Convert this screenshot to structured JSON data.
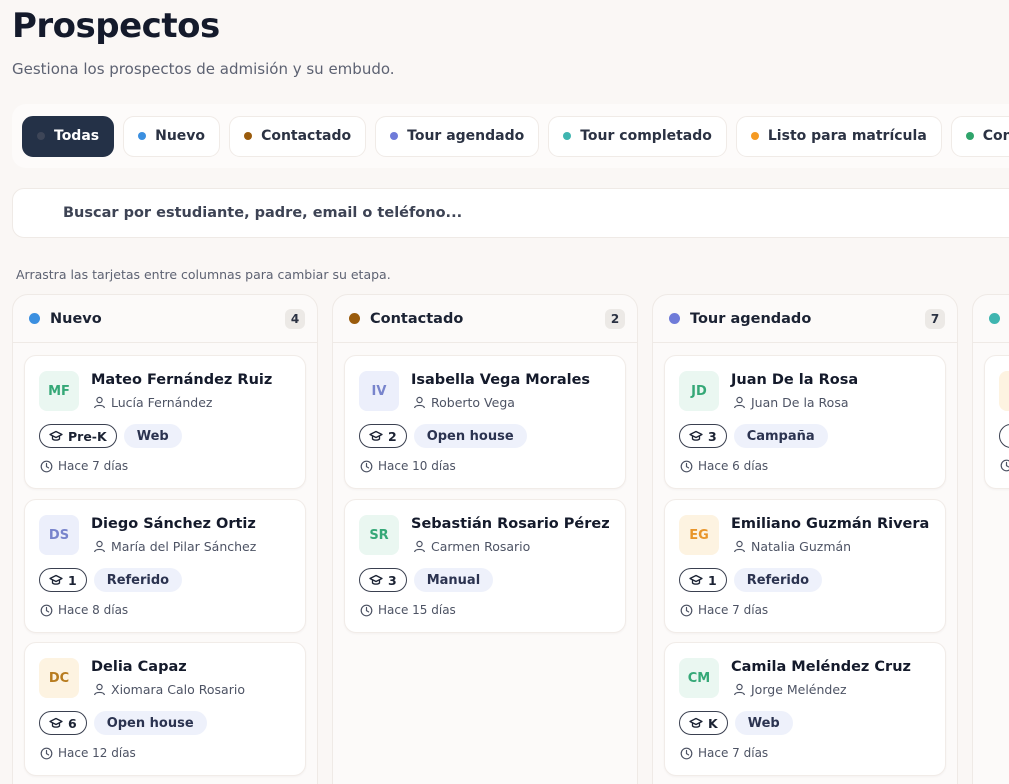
{
  "header": {
    "title": "Prospectos",
    "subtitle": "Gestiona los prospectos de admisión y su embudo."
  },
  "filters": [
    {
      "label": "Todas",
      "color": "#3d4557",
      "active": true
    },
    {
      "label": "Nuevo",
      "color": "#3b8fe0"
    },
    {
      "label": "Contactado",
      "color": "#9a5b0c"
    },
    {
      "label": "Tour agendado",
      "color": "#6f7bd9"
    },
    {
      "label": "Tour completado",
      "color": "#3fb5b0"
    },
    {
      "label": "Listo para matrícula",
      "color": "#f59a23"
    },
    {
      "label": "Convertido",
      "color": "#2fa46b"
    }
  ],
  "search": {
    "placeholder": "Buscar por estudiante, padre, email o teléfono...",
    "value": ""
  },
  "hint": "Arrastra las tarjetas entre columnas para cambiar su etapa.",
  "columns": [
    {
      "title": "Nuevo",
      "count": "4",
      "color": "#3b8fe0",
      "cards": [
        {
          "initials": "MF",
          "name": "Mateo Fernández Ruiz",
          "parent": "Lucía Fernández",
          "grade": "Pre-K",
          "source": "Web",
          "time": "Hace 7 días",
          "avatar_bg": "#eaf7f1",
          "avatar_fg": "#35a877"
        },
        {
          "initials": "DS",
          "name": "Diego Sánchez Ortiz",
          "parent": "María del Pilar Sánchez",
          "grade": "1",
          "source": "Referido",
          "time": "Hace 8 días",
          "avatar_bg": "#eceffb",
          "avatar_fg": "#7884cc"
        },
        {
          "initials": "DC",
          "name": "Delia Capaz",
          "parent": "Xiomara Calo Rosario",
          "grade": "6",
          "source": "Open house",
          "time": "Hace 12 días",
          "avatar_bg": "#fdf3e1",
          "avatar_fg": "#b77b1e"
        }
      ]
    },
    {
      "title": "Contactado",
      "count": "2",
      "color": "#9a5b0c",
      "cards": [
        {
          "initials": "IV",
          "name": "Isabella Vega Morales",
          "parent": "Roberto Vega",
          "grade": "2",
          "source": "Open house",
          "time": "Hace 10 días",
          "avatar_bg": "#eceffb",
          "avatar_fg": "#7884cc"
        },
        {
          "initials": "SR",
          "name": "Sebastián Rosario Pérez",
          "parent": "Carmen Rosario",
          "grade": "3",
          "source": "Manual",
          "time": "Hace 15 días",
          "avatar_bg": "#eaf7f1",
          "avatar_fg": "#35a877"
        }
      ]
    },
    {
      "title": "Tour agendado",
      "count": "7",
      "color": "#6f7bd9",
      "cards": [
        {
          "initials": "JD",
          "name": "Juan De la Rosa",
          "parent": "Juan De la Rosa",
          "grade": "3",
          "source": "Campaña",
          "time": "Hace 6 días",
          "avatar_bg": "#eaf7f1",
          "avatar_fg": "#35a877"
        },
        {
          "initials": "EG",
          "name": "Emiliano Guzmán Rivera",
          "parent": "Natalia Guzmán",
          "grade": "1",
          "source": "Referido",
          "time": "Hace 7 días",
          "avatar_bg": "#fdf3e1",
          "avatar_fg": "#e8952a"
        },
        {
          "initials": "CM",
          "name": "Camila Meléndez Cruz",
          "parent": "Jorge Meléndez",
          "grade": "K",
          "source": "Web",
          "time": "Hace 7 días",
          "avatar_bg": "#eaf7f1",
          "avatar_fg": "#35a877"
        }
      ]
    },
    {
      "title": "",
      "count": "",
      "color": "#3fb5b0",
      "cards": [
        {
          "initials": "",
          "name": "",
          "parent": "",
          "grade": "",
          "source": "",
          "time": "",
          "avatar_bg": "#fdf3e1",
          "avatar_fg": "#e8952a"
        }
      ]
    }
  ]
}
